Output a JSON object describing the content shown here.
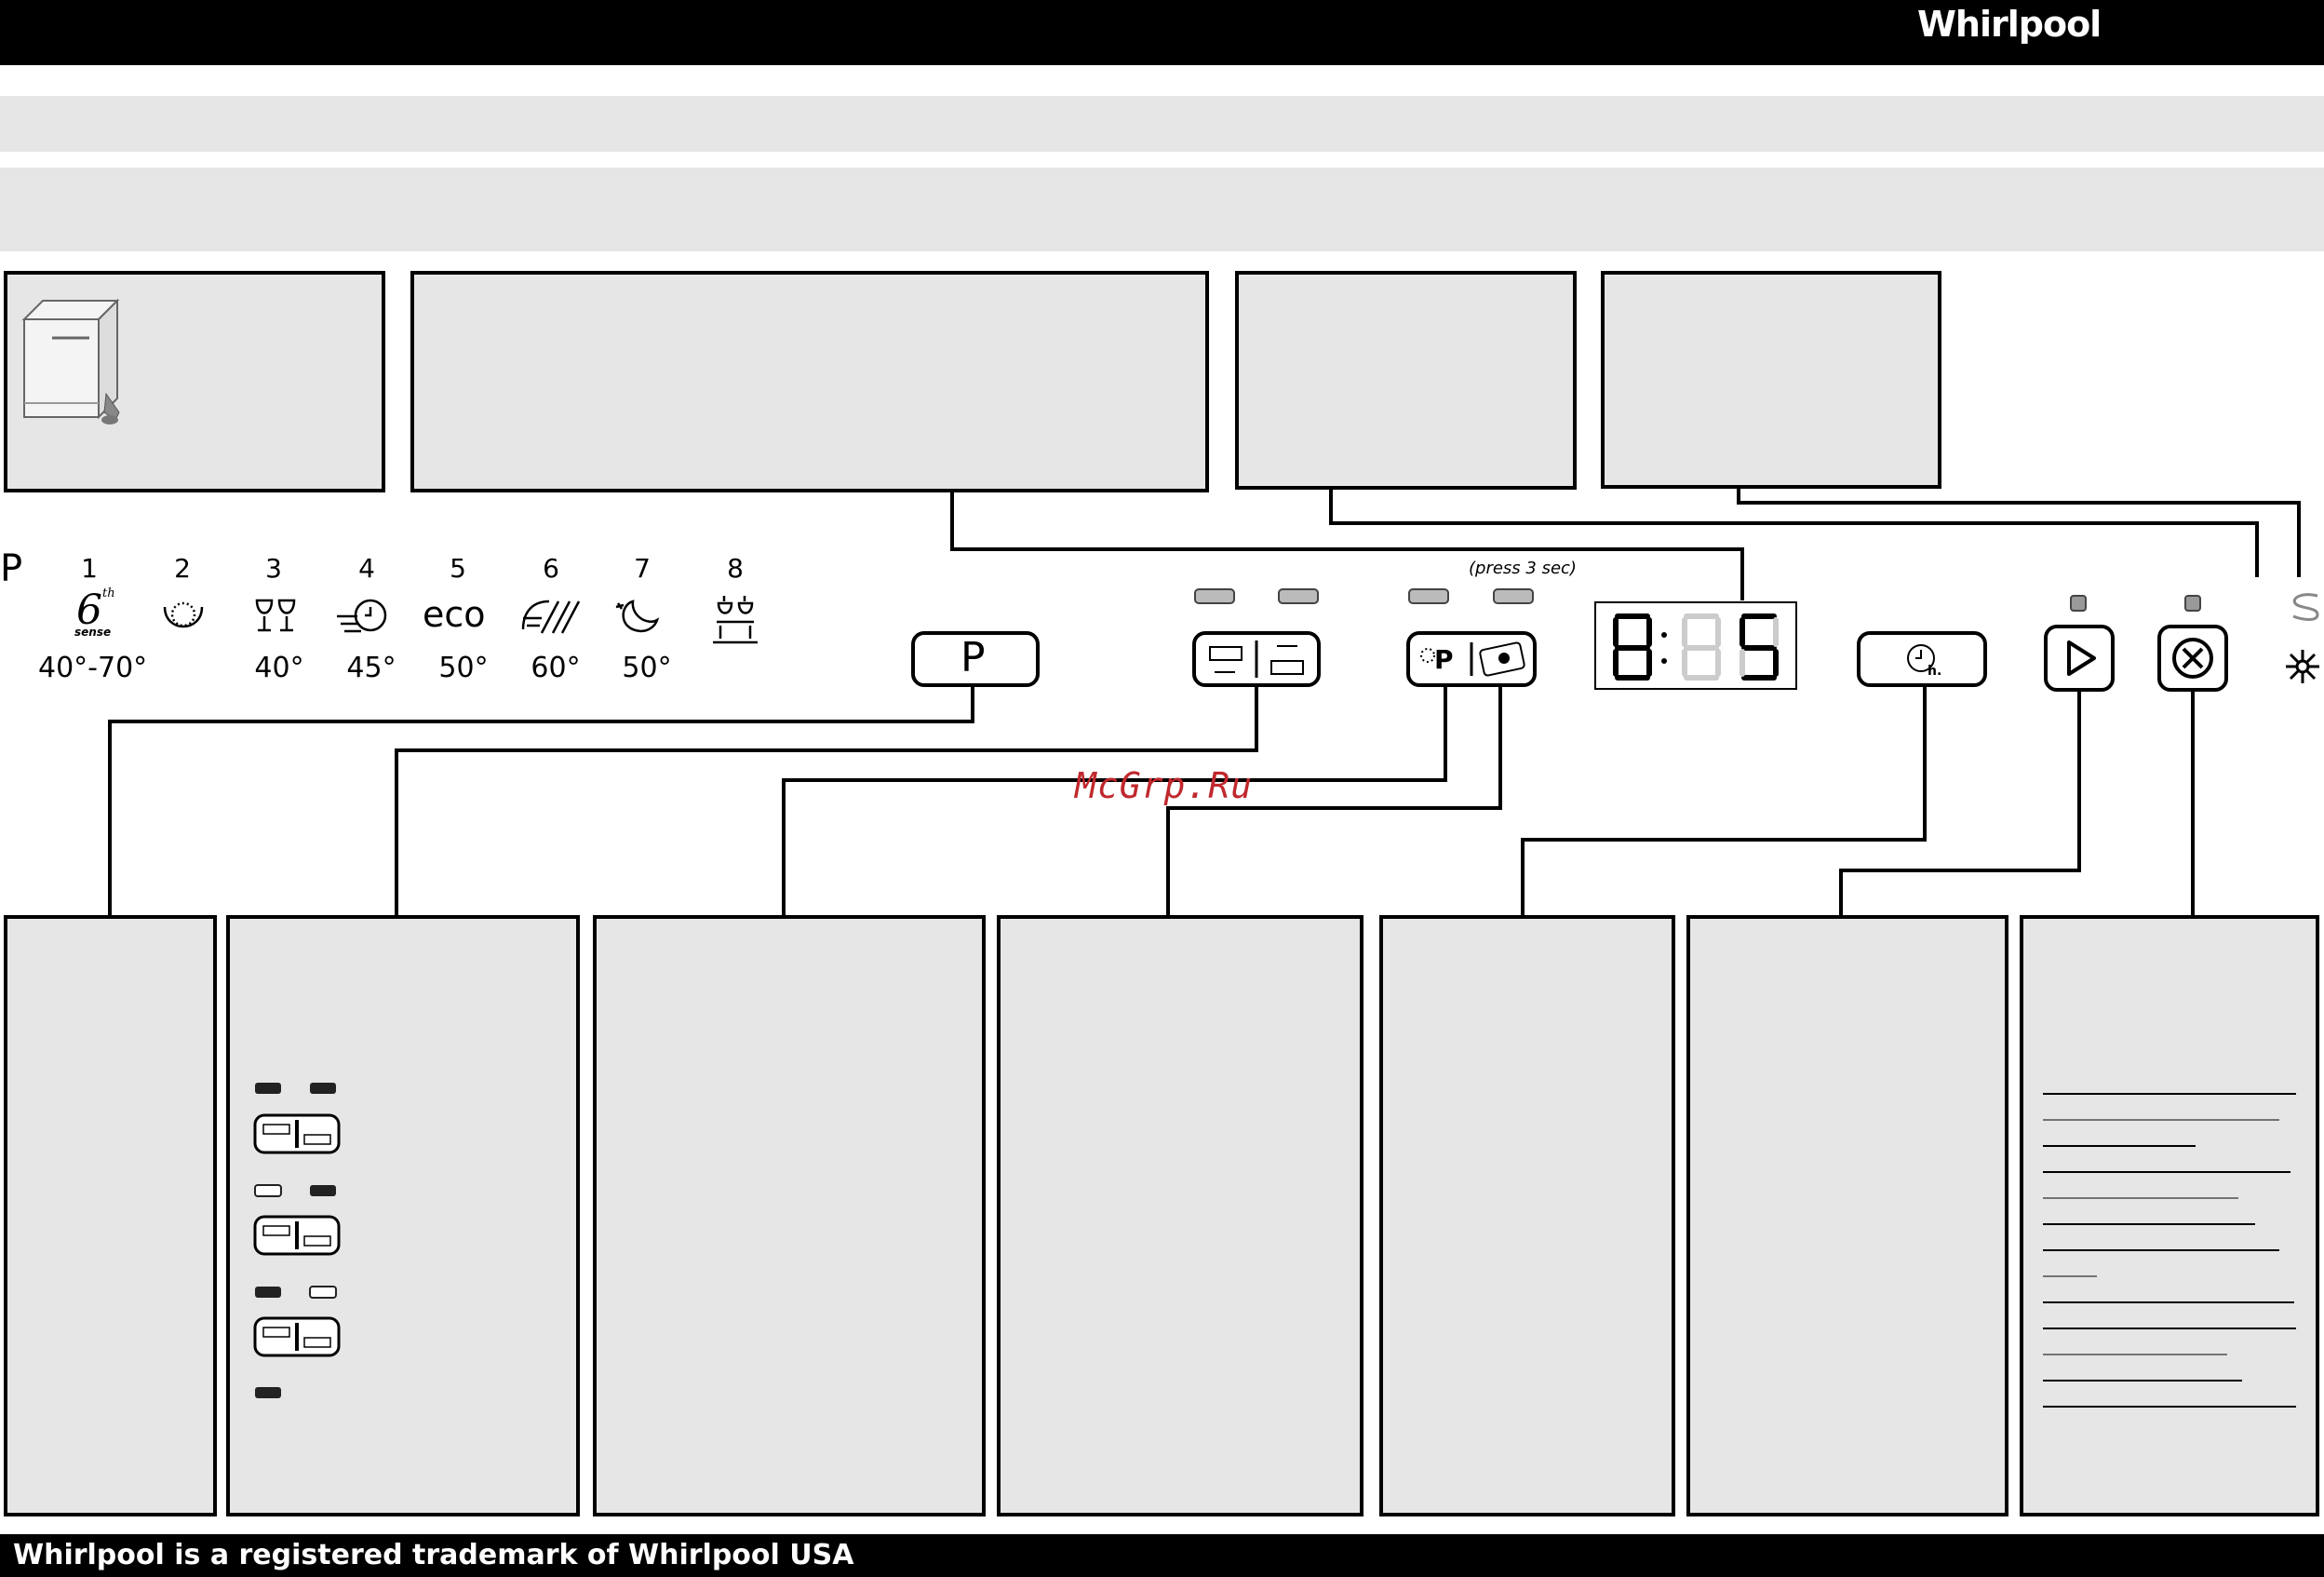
{
  "header": {
    "brand": "Whirlpool"
  },
  "footer": {
    "trademark": "Whirlpool is a registered trademark of Whirlpool USA"
  },
  "watermark": "McGrp.Ru",
  "panel": {
    "program_key_letter": "P",
    "programs": [
      {
        "num": "1",
        "icon": "6th-sense-icon",
        "icon_text": "6",
        "icon_sup": "th",
        "icon_sub": "sense",
        "temp": "40°-70°"
      },
      {
        "num": "2",
        "icon": "prewash-icon",
        "temp": ""
      },
      {
        "num": "3",
        "icon": "glasses-icon",
        "temp": "40°"
      },
      {
        "num": "4",
        "icon": "fast-wash-icon",
        "temp": "45°"
      },
      {
        "num": "5",
        "icon": "eco-icon",
        "icon_text": "eco",
        "temp": "50°"
      },
      {
        "num": "6",
        "icon": "intensive-icon",
        "temp": "60°"
      },
      {
        "num": "7",
        "icon": "night-icon",
        "temp": "50°"
      },
      {
        "num": "8",
        "icon": "rinse-glasses-icon",
        "temp": ""
      }
    ],
    "press_hint": "(press 3 sec)",
    "p_button_label": "P",
    "display_text": "8:88",
    "icons": {
      "half_load": "half-load-icon",
      "multifunction": "multifunction-icon",
      "delay_start": "delay-start-icon",
      "start": "start-icon",
      "cancel": "cancel-icon",
      "salt": "salt-icon",
      "rinse_aid": "rinse-aid-icon"
    },
    "salt_label": "S"
  },
  "half_load_states": [
    {
      "led_left": "on",
      "led_right": "on"
    },
    {
      "led_left": "off",
      "led_right": "on"
    },
    {
      "led_left": "on",
      "led_right": "off"
    },
    {
      "led_left": "on"
    }
  ],
  "colors": {
    "panel_fill": "#e6e6e6",
    "outline": "#000000",
    "watermark": "#c0282d"
  }
}
